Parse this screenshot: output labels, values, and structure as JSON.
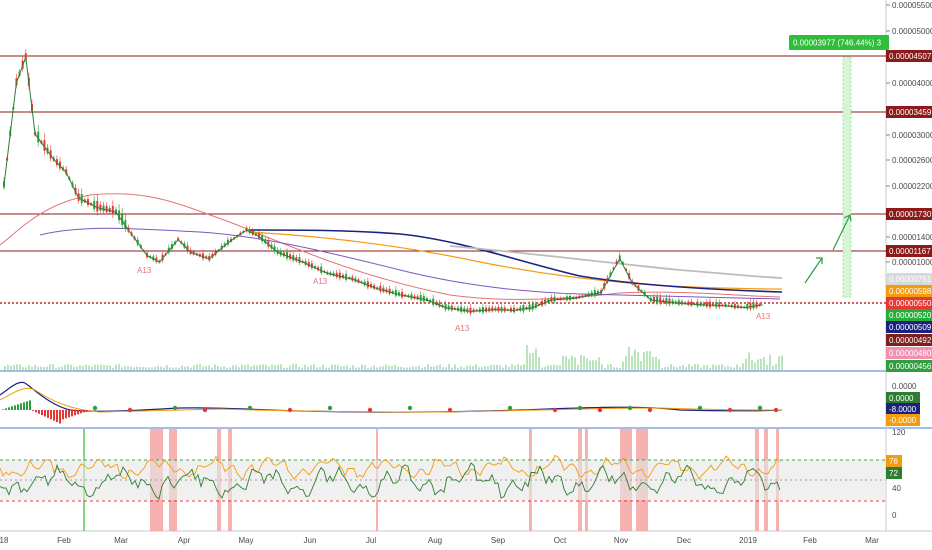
{
  "chart_data": {
    "type": "line",
    "price_axis_ticks": [
      "0.00005500",
      "0.00005000",
      "0.00004500",
      "0.00004000",
      "0.00003500",
      "0.00003000",
      "0.00002600",
      "0.00002200",
      "0.00001800",
      "0.00001400",
      "0.00001000"
    ],
    "month_labels": [
      "18",
      "Feb",
      "Mar",
      "Apr",
      "May",
      "Jun",
      "Jul",
      "Aug",
      "Sep",
      "Oct",
      "Nov",
      "Dec",
      "2019",
      "Feb",
      "Mar"
    ],
    "resistance_levels": [
      {
        "label": "0.00004507",
        "color": "#8b1a1a"
      },
      {
        "label": "0.00003459",
        "color": "#8b1a1a"
      },
      {
        "label": "0.00001730",
        "color": "#8b1a1a"
      },
      {
        "label": "0.00001167",
        "color": "#8b1a1a"
      }
    ],
    "target_badge": {
      "text": "0.00003977 (746.44%) 3",
      "color": "#2fbe3a"
    },
    "price_tags": [
      {
        "label": "0.00000751",
        "bg": "#d9d9d9",
        "fg": "#333333"
      },
      {
        "label": "0.00000598",
        "bg": "#f39c12",
        "fg": "#ffffff"
      },
      {
        "label": "0.00000550",
        "bg": "#e53935",
        "fg": "#ffffff"
      },
      {
        "label": "0.00000520",
        "bg": "#27ae3a",
        "fg": "#ffffff"
      },
      {
        "label": "0.00000509",
        "bg": "#1a237e",
        "fg": "#ffffff"
      },
      {
        "label": "0.00000492",
        "bg": "#7b1f1f",
        "fg": "#ffffff"
      },
      {
        "label": "0.00000480",
        "bg": "#f48fb1",
        "fg": "#ffffff"
      },
      {
        "label": "0.00000456",
        "bg": "#2e9e3e",
        "fg": "#ffffff"
      }
    ],
    "macd_axis": {
      "top_label": "0.0000"
    },
    "macd_tags": [
      {
        "label": "0.0000",
        "bg": "#2e7d32",
        "fg": "#ffffff"
      },
      {
        "label": "-8.0000",
        "bg": "#1a237e",
        "fg": "#ffffff"
      },
      {
        "label": "-0.0000",
        "bg": "#f39c12",
        "fg": "#ffffff"
      }
    ],
    "rsi_axis": {
      "ticks": [
        "120",
        "40",
        "0"
      ]
    },
    "rsi_tags": [
      {
        "label": "76",
        "bg": "#f39c12",
        "fg": "#ffffff"
      },
      {
        "label": "72",
        "bg": "#2e7d32",
        "fg": "#ffffff"
      }
    ],
    "price_series": [
      {
        "t": 0.0,
        "p": 2.2
      },
      {
        "t": 0.2,
        "p": 3.8
      },
      {
        "t": 0.35,
        "p": 4.2
      },
      {
        "t": 0.5,
        "p": 3.0
      },
      {
        "t": 0.8,
        "p": 2.6
      },
      {
        "t": 1.0,
        "p": 2.4
      },
      {
        "t": 1.2,
        "p": 2.0
      },
      {
        "t": 1.5,
        "p": 1.85
      },
      {
        "t": 1.8,
        "p": 1.78
      },
      {
        "t": 2.0,
        "p": 1.5
      },
      {
        "t": 2.3,
        "p": 1.1
      },
      {
        "t": 2.5,
        "p": 1.0
      },
      {
        "t": 2.8,
        "p": 1.35
      },
      {
        "t": 3.0,
        "p": 1.15
      },
      {
        "t": 3.3,
        "p": 1.05
      },
      {
        "t": 3.6,
        "p": 1.3
      },
      {
        "t": 3.9,
        "p": 1.5
      },
      {
        "t": 4.1,
        "p": 1.4
      },
      {
        "t": 4.4,
        "p": 1.15
      },
      {
        "t": 4.8,
        "p": 1.0
      },
      {
        "t": 5.2,
        "p": 0.88
      },
      {
        "t": 5.6,
        "p": 0.82
      },
      {
        "t": 6.0,
        "p": 0.72
      },
      {
        "t": 6.4,
        "p": 0.65
      },
      {
        "t": 6.8,
        "p": 0.6
      },
      {
        "t": 7.1,
        "p": 0.52
      },
      {
        "t": 7.5,
        "p": 0.48
      },
      {
        "t": 7.9,
        "p": 0.5
      },
      {
        "t": 8.2,
        "p": 0.49
      },
      {
        "t": 8.5,
        "p": 0.52
      },
      {
        "t": 8.8,
        "p": 0.6
      },
      {
        "t": 9.2,
        "p": 0.62
      },
      {
        "t": 9.6,
        "p": 0.68
      },
      {
        "t": 9.9,
        "p": 1.05
      },
      {
        "t": 10.1,
        "p": 0.78
      },
      {
        "t": 10.4,
        "p": 0.6
      },
      {
        "t": 10.8,
        "p": 0.57
      },
      {
        "t": 11.2,
        "p": 0.55
      },
      {
        "t": 11.6,
        "p": 0.54
      },
      {
        "t": 11.9,
        "p": 0.52
      },
      {
        "t": 12.2,
        "p": 0.55
      }
    ]
  }
}
